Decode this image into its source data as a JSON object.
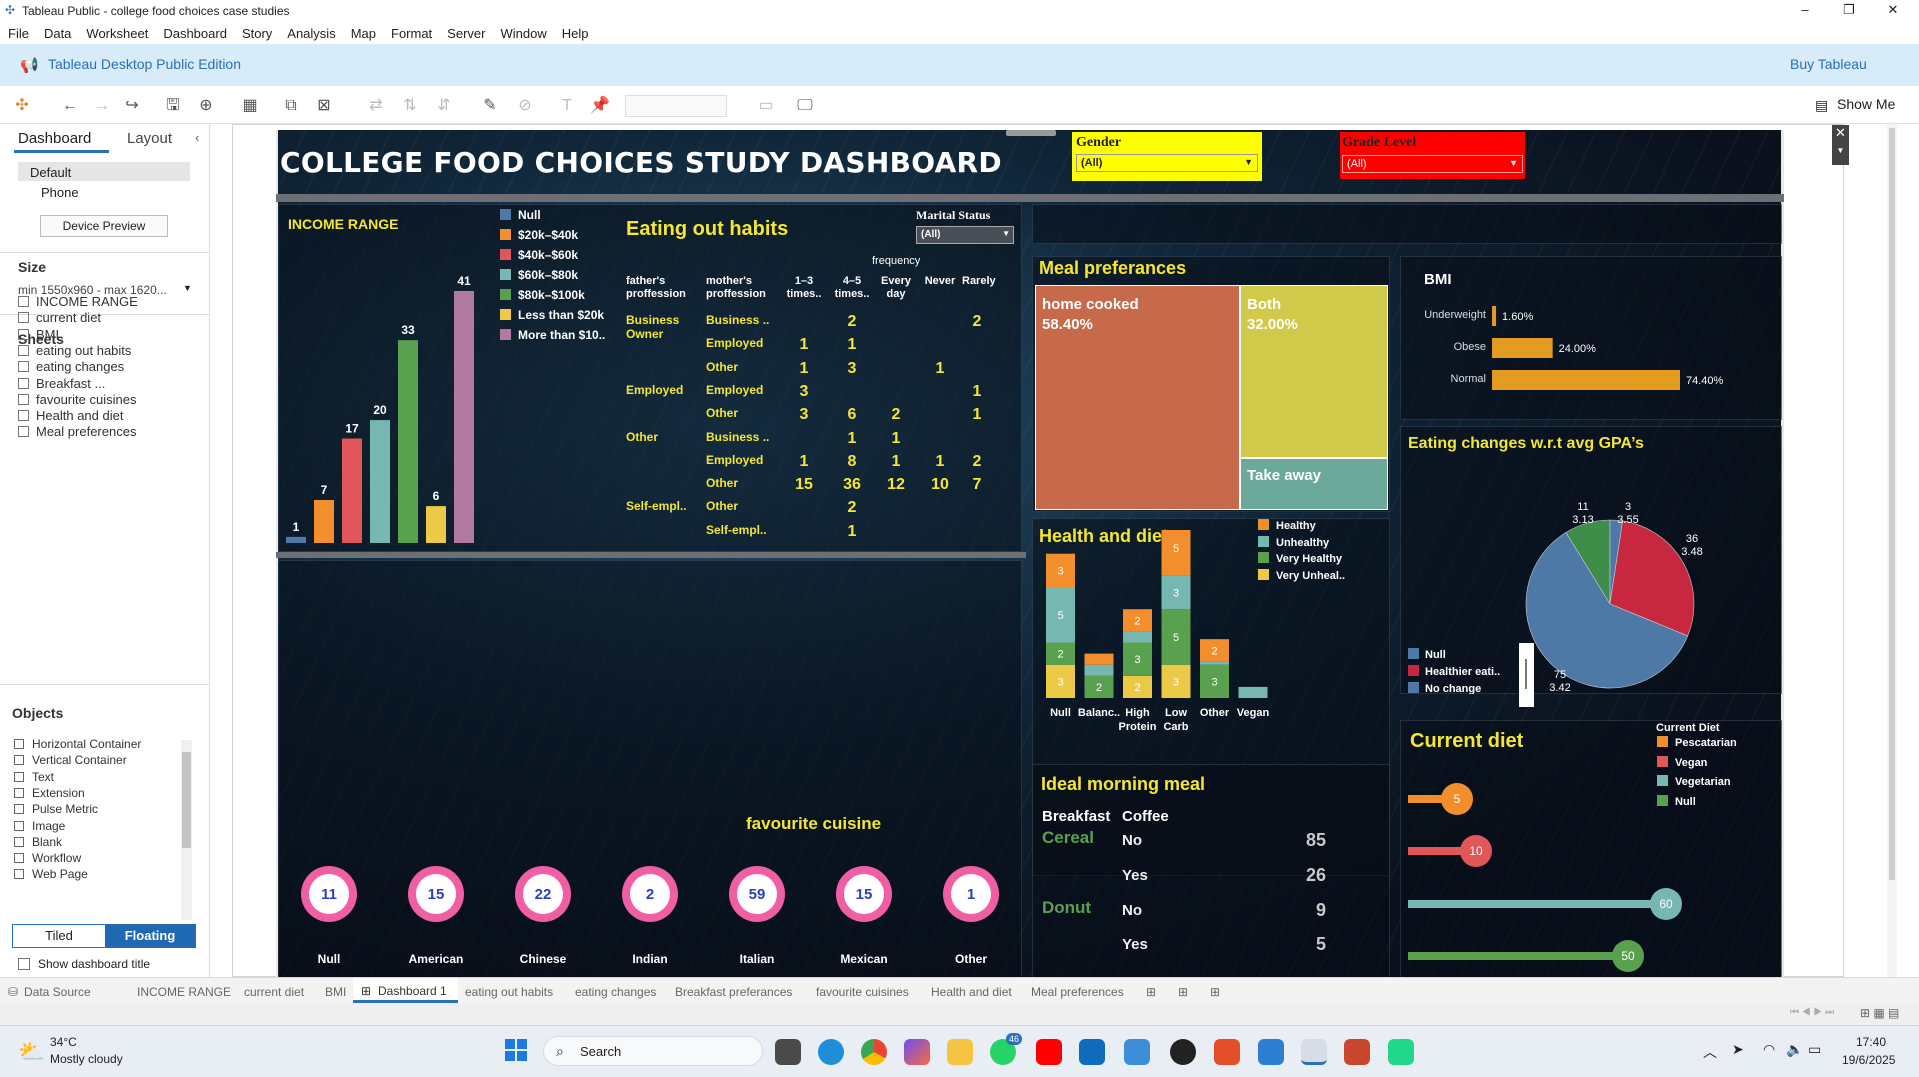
{
  "window": {
    "title": "Tableau Public - college food choices case studies"
  },
  "menu": [
    "File",
    "Data",
    "Worksheet",
    "Dashboard",
    "Story",
    "Analysis",
    "Map",
    "Format",
    "Server",
    "Window",
    "Help"
  ],
  "edition": {
    "label": "Tableau Desktop Public Edition",
    "buy": "Buy Tableau"
  },
  "toolbar": {
    "show_me": "Show Me"
  },
  "left": {
    "tabs": [
      "Dashboard",
      "Layout"
    ],
    "devices": [
      "Default",
      "Phone"
    ],
    "device_preview": "Device Preview",
    "size_header": "Size",
    "size_value": "min 1550x960 - max 1620...",
    "sheets_header": "Sheets",
    "sheets": [
      "INCOME RANGE",
      "current diet",
      "BMI",
      "eating out habits",
      "eating changes",
      "Breakfast ...",
      "favourite cuisines",
      "Health and diet",
      "Meal preferences"
    ],
    "objects_header": "Objects",
    "objects": [
      "Horizontal Container",
      "Vertical Container",
      "Text",
      "Extension",
      "Pulse Metric",
      "Image",
      "Blank",
      "Workflow",
      "Web Page"
    ],
    "tiled": "Tiled",
    "floating": "Floating",
    "show_title": "Show dashboard title"
  },
  "dashboard": {
    "title": "COLLEGE FOOD CHOICES STUDY DASHBOARD",
    "filters": {
      "gender_label": "Gender",
      "gender_value": "(All)",
      "grade_label": "Grade Level",
      "grade_value": "(All)",
      "marital_label": "Marital Status",
      "marital_value": "(All)"
    },
    "income": {
      "title": "INCOME RANGE",
      "legend": [
        "Null",
        "$20k–$40k",
        "$40k–$60k",
        "$60k–$80k",
        "$80k–$100k",
        "Less than $20k",
        "More than $10.."
      ],
      "colors": [
        "#4e79a7",
        "#f28e2b",
        "#e15759",
        "#76b7b2",
        "#59a14f",
        "#edc948",
        "#b07aa1"
      ]
    },
    "eating_out": {
      "title": "Eating out habits",
      "freq_label": "frequency",
      "head": [
        "father's proffession",
        "mother's proffession",
        "1–3 times..",
        "4–5 times..",
        "Every day",
        "Never",
        "Rarely"
      ],
      "rows": [
        [
          "Business Owner",
          "Business ..",
          "",
          "2",
          "",
          "",
          "2"
        ],
        [
          "",
          "Employed",
          "1",
          "1",
          "",
          "",
          ""
        ],
        [
          "",
          "Other",
          "1",
          "3",
          "",
          "1",
          ""
        ],
        [
          "Employed",
          "Employed",
          "3",
          "",
          "",
          "",
          "1"
        ],
        [
          "",
          "Other",
          "3",
          "6",
          "2",
          "",
          "1"
        ],
        [
          "Other",
          "Business ..",
          "",
          "1",
          "1",
          "",
          ""
        ],
        [
          "",
          "Employed",
          "1",
          "8",
          "1",
          "1",
          "2"
        ],
        [
          "",
          "Other",
          "15",
          "36",
          "12",
          "10",
          "7"
        ],
        [
          "Self-empl..",
          "Other",
          "",
          "2",
          "",
          "",
          ""
        ],
        [
          "",
          "Self-empl..",
          "",
          "1",
          "",
          "",
          ""
        ]
      ]
    },
    "meal_pref": {
      "title": "Meal preferances",
      "cells": [
        {
          "label": "home cooked",
          "pct": "58.40%"
        },
        {
          "label": "Both",
          "pct": "32.00%"
        },
        {
          "label": "Take away",
          "pct": ""
        }
      ]
    },
    "bmi": {
      "title": "BMI",
      "labels": [
        "Underweight",
        "Obese",
        "Normal"
      ],
      "values": [
        "1.60%",
        "24.00%",
        "74.40%"
      ]
    },
    "gpa": {
      "title": "Eating changes w.r.t avg GPA’s",
      "legend": [
        "Null",
        "Healthier eati..",
        "No change"
      ],
      "labels": [
        {
          "n": "11",
          "g": "3.13"
        },
        {
          "n": "3",
          "g": "3.55"
        },
        {
          "n": "36",
          "g": "3.48"
        },
        {
          "n": "75",
          "g": "3.42"
        }
      ]
    },
    "health": {
      "title": "Health and diet",
      "legend": [
        "Healthy",
        "Unhealthy",
        "Very Healthy",
        "Very Unheal.."
      ],
      "cats": [
        "Null",
        "Balanc..",
        "High Protein",
        "Low Carb",
        "Other",
        "Vegan"
      ],
      "seg_labels": [
        "3",
        "5",
        "2",
        "3",
        "2",
        "2",
        "3",
        "2",
        "3",
        "5",
        "3",
        "5",
        "3",
        "2",
        "3",
        "1"
      ]
    },
    "morning": {
      "title": "Ideal morning meal",
      "col1": "Breakfast",
      "col2": "Coffee",
      "rows": [
        {
          "b": "Cereal",
          "c": "No",
          "v": "85"
        },
        {
          "b": "",
          "c": "Yes",
          "v": "26"
        },
        {
          "b": "Donut",
          "c": "No",
          "v": "9"
        },
        {
          "b": "",
          "c": "Yes",
          "v": "5"
        }
      ]
    },
    "current": {
      "title": "Current diet",
      "legend_title": "Current Diet",
      "legend": [
        "Pescatarian",
        "Vegan",
        "Vegetarian",
        "Null"
      ],
      "values": [
        "5",
        "10",
        "60",
        "50"
      ]
    },
    "cuisine": {
      "title": "favourite cuisine",
      "items": [
        {
          "c": "Null",
          "v": "11"
        },
        {
          "c": "American",
          "v": "15"
        },
        {
          "c": "Chinese",
          "v": "22"
        },
        {
          "c": "Indian",
          "v": "2"
        },
        {
          "c": "Italian",
          "v": "59"
        },
        {
          "c": "Mexican",
          "v": "15"
        },
        {
          "c": "Other",
          "v": "1"
        }
      ]
    }
  },
  "chart_data": [
    {
      "type": "bar",
      "title": "INCOME RANGE",
      "categories": [
        "Null",
        "$20k–$40k",
        "$40k–$60k",
        "$60k–$80k",
        "$80k–$100k",
        "Less than $20k",
        "More than $10.."
      ],
      "values": [
        1,
        7,
        17,
        20,
        33,
        6,
        41
      ]
    },
    {
      "type": "bar",
      "title": "BMI",
      "categories": [
        "Underweight",
        "Obese",
        "Normal"
      ],
      "values": [
        1.6,
        24.0,
        74.4
      ]
    },
    {
      "type": "pie",
      "title": "Eating changes w.r.t avg GPA’s",
      "slices": [
        {
          "count": 75,
          "gpa": 3.42
        },
        {
          "count": 11,
          "gpa": 3.13
        },
        {
          "count": 3,
          "gpa": 3.55
        },
        {
          "count": 36,
          "gpa": 3.48
        }
      ]
    },
    {
      "type": "bar",
      "title": "Health and diet",
      "categories": [
        "Null",
        "Balanc..",
        "High Protein",
        "Low Carb",
        "Other",
        "Vegan"
      ],
      "series": [
        {
          "name": "Healthy",
          "values": [
            3,
            1,
            2,
            5,
            2,
            null
          ]
        },
        {
          "name": "Unhealthy",
          "values": [
            3,
            2,
            2,
            3,
            null,
            null
          ]
        },
        {
          "name": "Very Healthy",
          "values": [
            2,
            2,
            3,
            5,
            3,
            1
          ]
        },
        {
          "name": "Very Unheal..",
          "values": [
            5,
            null,
            null,
            null,
            null,
            null
          ]
        }
      ]
    },
    {
      "type": "bar",
      "title": "Current diet",
      "categories": [
        "Pescatarian",
        "Vegan",
        "Vegetarian",
        "Null"
      ],
      "values": [
        5,
        10,
        60,
        50
      ]
    },
    {
      "type": "bar",
      "title": "favourite cuisine",
      "categories": [
        "Null",
        "American",
        "Chinese",
        "Indian",
        "Italian",
        "Mexican",
        "Other"
      ],
      "values": [
        11,
        15,
        22,
        2,
        59,
        15,
        1
      ]
    }
  ],
  "tabs": [
    "Data Source",
    "INCOME RANGE",
    "current diet",
    "BMI",
    "Dashboard 1",
    "eating out habits",
    "eating changes",
    "Breakfast preferances",
    "favourite cuisines",
    "Health and diet",
    "Meal preferences"
  ],
  "taskbar": {
    "weather_temp": "34°C",
    "weather_desc": "Mostly cloudy",
    "search": "Search",
    "time": "17:40",
    "date": "19/6/2025",
    "badge": "46"
  }
}
